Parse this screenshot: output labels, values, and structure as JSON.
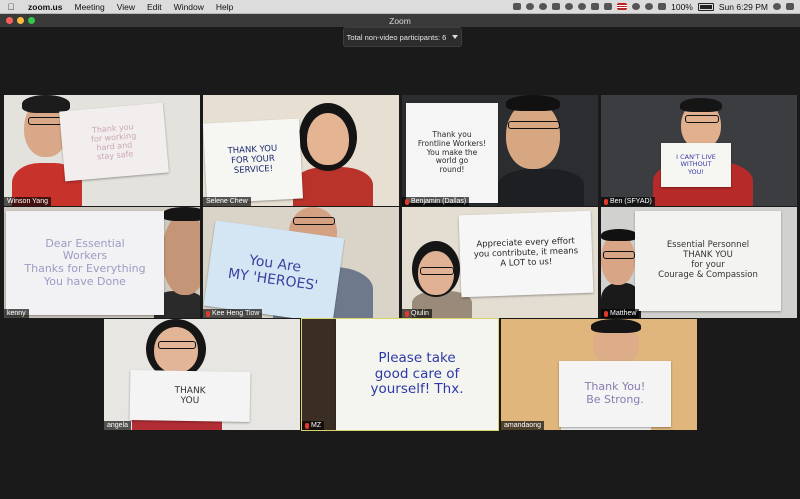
{
  "menubar": {
    "app": "zoom.us",
    "items": [
      "Meeting",
      "View",
      "Edit",
      "Window",
      "Help"
    ],
    "battery": "100%",
    "clock": "Sun 6:29 PM"
  },
  "window": {
    "title": "Zoom"
  },
  "participants_pill": {
    "label": "Total non-video participants: 6"
  },
  "tiles": [
    {
      "name": "Winson Yang",
      "sign": "Thank you\nfor working\nhard and\nstay safe"
    },
    {
      "name": "Selene Chew",
      "sign": "THANK YOU\nFOR YOUR\nSERVICE!"
    },
    {
      "name": "Benjamin (Dallas)",
      "sign": "Thank you\nFrontline Workers!\nYou make the\nworld go\nround!"
    },
    {
      "name": "Ben (SFYAD)",
      "sign": "I CAN'T LIVE\nWITHOUT\nYOU!"
    },
    {
      "name": "kenny",
      "sign": "Dear Essential\nWorkers\nThanks for Everything\nYou have Done"
    },
    {
      "name": "Kee Heng Tiow",
      "sign": "You Are\nMY 'HEROES'"
    },
    {
      "name": "Qiulin",
      "sign": "Appreciate every effort\nyou contribute, it means\nA LOT to us!"
    },
    {
      "name": "Matthew",
      "sign": "Essential Personnel\nTHANK YOU\nfor your\nCourage & Compassion"
    },
    {
      "name": "angela",
      "sign": "THANK\nYOU"
    },
    {
      "name": "MZ",
      "sign": "Please take\ngood care of\nyourself! Thx."
    },
    {
      "name": "amandaong",
      "sign": "Thank You!\nBe Strong."
    }
  ]
}
